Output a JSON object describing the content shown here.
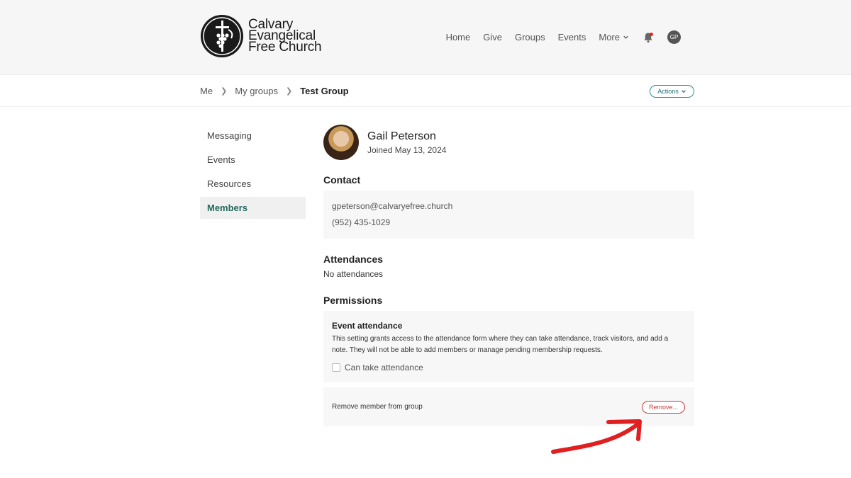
{
  "header": {
    "logo_lines": [
      "Calvary",
      "Evangelical",
      "Free Church"
    ],
    "nav": [
      "Home",
      "Give",
      "Groups",
      "Events",
      "More"
    ],
    "user_initials": "GP"
  },
  "breadcrumb": {
    "items": [
      "Me",
      "My groups"
    ],
    "current": "Test Group"
  },
  "actions_label": "Actions",
  "sidebar": {
    "items": [
      {
        "label": "Messaging",
        "active": false
      },
      {
        "label": "Events",
        "active": false
      },
      {
        "label": "Resources",
        "active": false
      },
      {
        "label": "Members",
        "active": true
      }
    ]
  },
  "member": {
    "name": "Gail Peterson",
    "joined": "Joined May 13, 2024"
  },
  "contact": {
    "title": "Contact",
    "email": "gpeterson@calvaryefree.church",
    "phone": "(952) 435-1029"
  },
  "attendances": {
    "title": "Attendances",
    "text": "No attendances"
  },
  "permissions": {
    "title": "Permissions",
    "heading": "Event attendance",
    "description": "This setting grants access to the attendance form where they can take attendance, track visitors, and add a note. They will not be able to add members or manage pending membership requests.",
    "checkbox_label": "Can take attendance",
    "checked": false
  },
  "remove": {
    "label": "Remove member from group",
    "button": "Remove..."
  },
  "colors": {
    "accent_teal": "#246b5e",
    "danger": "#c93a3a",
    "annotation": "#e02020"
  }
}
